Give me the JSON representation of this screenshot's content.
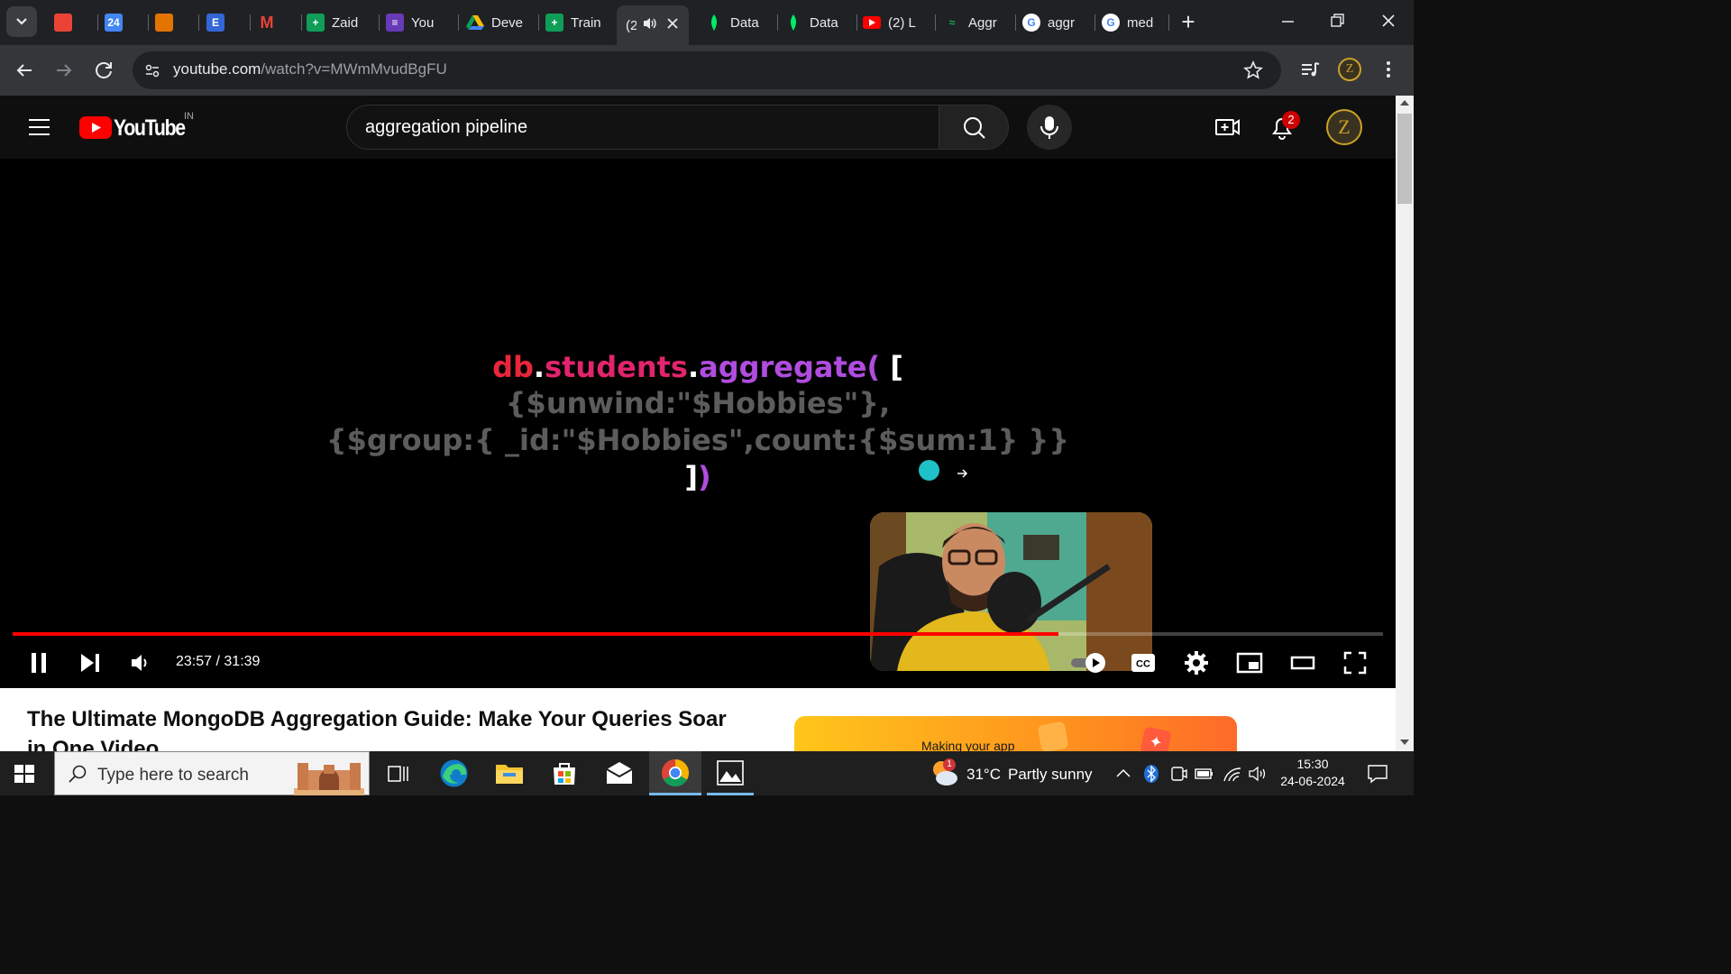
{
  "tabs": [
    {
      "label": "",
      "icon": "tab-favicon-1",
      "color": "#ea4335"
    },
    {
      "label": "24",
      "icon": "tab-favicon-calendar",
      "color": "#4285f4"
    },
    {
      "label": "",
      "icon": "tab-favicon-3",
      "color": "#e37400"
    },
    {
      "label": "E",
      "icon": "tab-favicon-e",
      "color": "#3367d6"
    },
    {
      "label": "M",
      "icon": "gmail-icon",
      "color": "#ea4335"
    },
    {
      "label": "Zaid",
      "icon": "sheets-icon",
      "color": "#0f9d58"
    },
    {
      "label": "You",
      "icon": "forms-icon",
      "color": "#673ab7"
    },
    {
      "label": "Deve",
      "icon": "drive-icon",
      "color": "#fbbc04"
    },
    {
      "label": "Train",
      "icon": "sheets-icon",
      "color": "#0f9d58"
    },
    {
      "label": "(2",
      "icon": "audio-icon",
      "color": "#e8eaed"
    },
    {
      "label": "Data",
      "icon": "mongodb-icon",
      "color": "#00ed64"
    },
    {
      "label": "Data",
      "icon": "mongodb-icon",
      "color": "#00ed64"
    },
    {
      "label": "(2) L",
      "icon": "youtube-icon",
      "color": "#ff0000"
    },
    {
      "label": "Aggr",
      "icon": "tab-favicon-aggr",
      "color": "#13aa52"
    },
    {
      "label": "aggr",
      "icon": "google-icon",
      "color": "#4285f4"
    },
    {
      "label": "med",
      "icon": "google-icon",
      "color": "#4285f4"
    }
  ],
  "new_tab": "+",
  "address": {
    "domain": "youtube.com",
    "path": "/watch?v=MWmMvudBgFU"
  },
  "profile_initial": "Z",
  "youtube": {
    "logo_text": "YouTube",
    "region": "IN",
    "search_value": "aggregation pipeline",
    "notification_count": "2",
    "avatar_initial": "Z"
  },
  "video": {
    "code_line1_a": "db",
    "code_line1_dot1": ".",
    "code_line1_b": "students",
    "code_line1_dot2": ".",
    "code_line1_c": "aggregate(",
    "code_line1_d": " [",
    "code_line2": "{$unwind:\"$Hobbies\"},",
    "code_line3": "{$group:{ _id:\"$Hobbies\",count:{$sum:1} }}",
    "code_line4_a": "]",
    "code_line4_b": ")",
    "time_current": "23:57",
    "time_sep": " / ",
    "time_total": "31:39",
    "progress": 0.7629,
    "colors": {
      "red": "#e8263a",
      "pink": "#e2246d",
      "purple": "#b04cdf",
      "grey": "#5c5c5c",
      "progress": "#ff0000"
    }
  },
  "title": "The Ultimate MongoDB Aggregation Guide: Make Your Queries Soar in One Video",
  "ad_text": "Making your app",
  "taskbar": {
    "search_placeholder": "Type here to search",
    "weather_temp": "31°C",
    "weather_desc": "Partly sunny",
    "weather_badge": "1",
    "time": "15:30",
    "date": "24-06-2024"
  }
}
